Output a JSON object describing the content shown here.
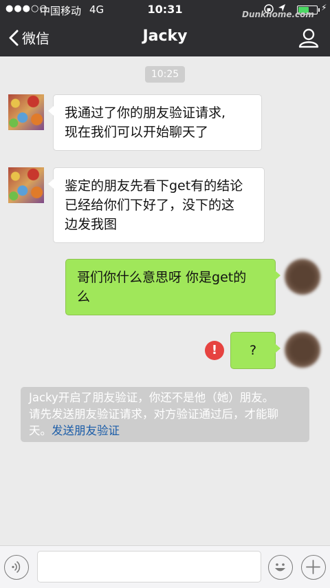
{
  "status_bar": {
    "signal": "●●●○○",
    "carrier": "中国移动",
    "network": "4G",
    "time": "10:31",
    "battery_level": 0.55,
    "battery_color": "#4cd964"
  },
  "watermark": "Dunkhome.com",
  "nav": {
    "back_label": "微信",
    "title": "Jacky",
    "profile_icon": "person-icon"
  },
  "chat": {
    "timestamp": "10:25",
    "messages": [
      {
        "side": "in",
        "line1": "我通过了你的朋友验证请求,",
        "line2": "现在我们可以开始聊天了"
      },
      {
        "side": "in",
        "line1": "鉴定的朋友先看下get有的结论",
        "line2": "已经给你们下好了，没下的这",
        "line3": "边发我图"
      },
      {
        "side": "out",
        "line1": "哥们你什么意思呀 你是get的",
        "line2": "么"
      },
      {
        "side": "out",
        "line1": "?",
        "status": "failed"
      }
    ],
    "failed_icon": "!",
    "system_note": {
      "line1": "Jacky开启了朋友验证，你还不是他（她）朋友。",
      "line2": "请先发送朋友验证请求，对方验证通过后，才能聊",
      "line3_prefix": "天。",
      "link": "发送朋友验证"
    }
  },
  "input_bar": {
    "voice_icon": "voice-icon",
    "emoji_icon": "emoji-icon",
    "plus_icon": "plus-icon",
    "text_value": ""
  },
  "colors": {
    "nav_bg": "#2e2e31",
    "chat_bg": "#ebebeb",
    "bubble_out": "#a0e75a",
    "bubble_in": "#ffffff",
    "error_red": "#e64340",
    "link": "#1a5ca8"
  }
}
